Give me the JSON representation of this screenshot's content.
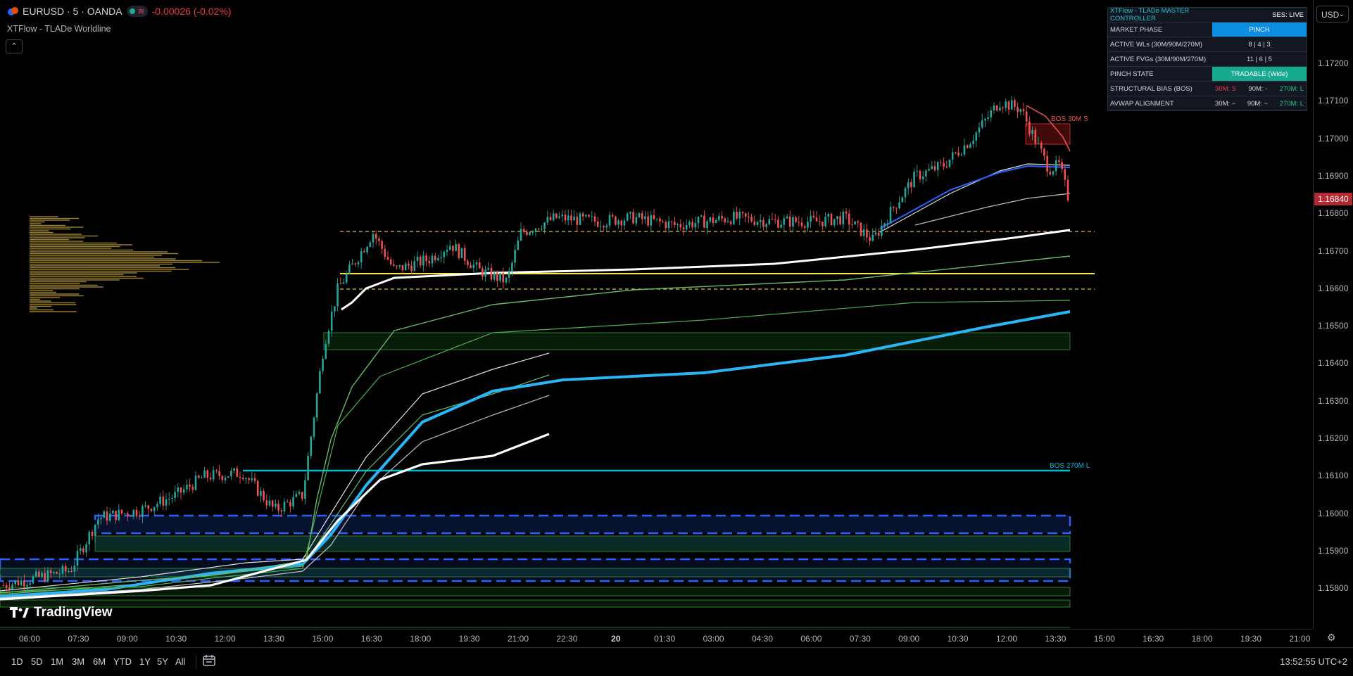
{
  "header": {
    "symbol": "EURUSD · 5 · OANDA",
    "wave_glyph": "≋",
    "change": "-0.00026 (-0.02%)",
    "indicator_name": "XTFlow - TLADe Worldline",
    "collapse_glyph": "⌃",
    "currency": "USD"
  },
  "price_scale": {
    "ticks": [
      "1.17200",
      "1.17100",
      "1.17000",
      "1.16900",
      "1.16800",
      "1.16700",
      "1.16600",
      "1.16500",
      "1.16400",
      "1.16300",
      "1.16200",
      "1.16100",
      "1.16000",
      "1.15900",
      "1.15800"
    ],
    "current_price": "1.16840"
  },
  "time_axis": {
    "ticks": [
      {
        "label": "06:00",
        "bold": false
      },
      {
        "label": "07:30",
        "bold": false
      },
      {
        "label": "09:00",
        "bold": false
      },
      {
        "label": "10:30",
        "bold": false
      },
      {
        "label": "12:00",
        "bold": false
      },
      {
        "label": "13:30",
        "bold": false
      },
      {
        "label": "15:00",
        "bold": false
      },
      {
        "label": "16:30",
        "bold": false
      },
      {
        "label": "18:00",
        "bold": false
      },
      {
        "label": "19:30",
        "bold": false
      },
      {
        "label": "21:00",
        "bold": false
      },
      {
        "label": "22:30",
        "bold": false
      },
      {
        "label": "20",
        "bold": true
      },
      {
        "label": "01:30",
        "bold": false
      },
      {
        "label": "03:00",
        "bold": false
      },
      {
        "label": "04:30",
        "bold": false
      },
      {
        "label": "06:00",
        "bold": false
      },
      {
        "label": "07:30",
        "bold": false
      },
      {
        "label": "09:00",
        "bold": false
      },
      {
        "label": "10:30",
        "bold": false
      },
      {
        "label": "12:00",
        "bold": false
      },
      {
        "label": "13:30",
        "bold": false
      },
      {
        "label": "15:00",
        "bold": false
      },
      {
        "label": "16:30",
        "bold": false
      },
      {
        "label": "18:00",
        "bold": false
      },
      {
        "label": "19:30",
        "bold": false
      },
      {
        "label": "21:00",
        "bold": false
      }
    ]
  },
  "bottom_bar": {
    "ranges": [
      "1D",
      "5D",
      "1M",
      "3M",
      "6M",
      "YTD",
      "1Y",
      "5Y",
      "All"
    ],
    "clock": "13:52:55 UTC+2"
  },
  "branding": {
    "logo_text": "TradingView"
  },
  "annotations": {
    "bos_30m": "BOS 30M S",
    "bos_270m": "BOS 270M L"
  },
  "controller": {
    "title": "XTFlow - TLADe MASTER CONTROLLER",
    "session": "SES: LIVE",
    "rows": [
      {
        "label": "MARKET PHASE",
        "value": "PINCH"
      },
      {
        "label": "ACTIVE WLs (30M/90M/270M)",
        "value": "8 | 4 | 3"
      },
      {
        "label": "ACTIVE FVGs (30M/90M/270M)",
        "value": "11 | 6 | 5"
      },
      {
        "label": "PINCH STATE",
        "value": "TRADABLE (Wide)"
      },
      {
        "label": "STRUCTURAL BIAS (BOS)",
        "v1": "30M: S",
        "v2": "90M: -",
        "v3": "270M: L"
      },
      {
        "label": "AVWAP ALIGNMENT",
        "v1": "30M: ~",
        "v2": "90M: ~",
        "v3": "270M: L"
      }
    ]
  },
  "colors": {
    "bull": "#26a69a",
    "bear": "#ef5350",
    "cyan_line": "#29b6f6",
    "bos_line": "#00bcd4",
    "poc_line": "#f5e642",
    "volume_profile": "#c9a83a",
    "zone_green": "#1b5e20",
    "zone_blue": "#2962ff"
  }
}
